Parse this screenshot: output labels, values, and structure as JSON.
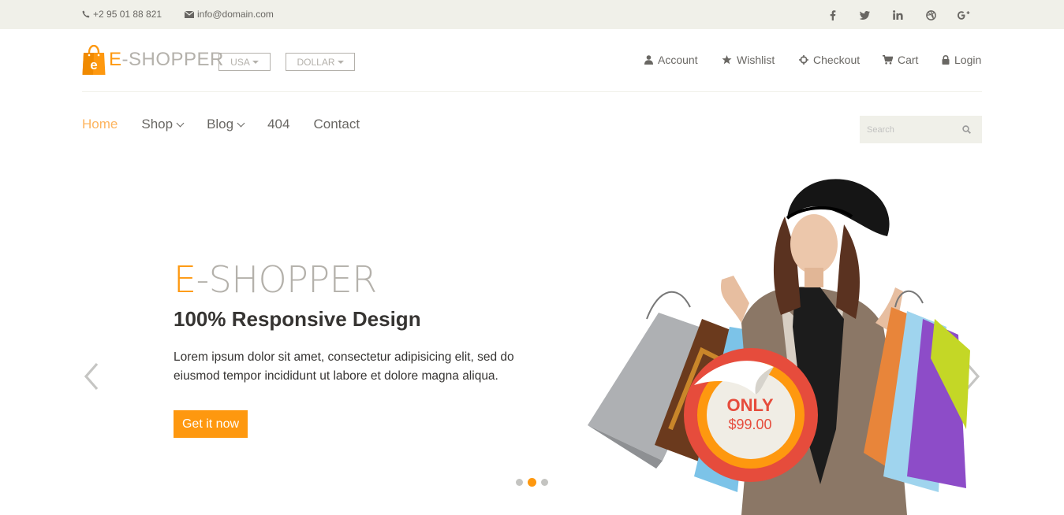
{
  "topbar": {
    "phone": "+2 95 01 88 821",
    "email": "info@domain.com",
    "social": [
      {
        "icon": "facebook-icon",
        "glyph": "f"
      },
      {
        "icon": "twitter-icon",
        "glyph": "t"
      },
      {
        "icon": "linkedin-icon",
        "glyph": "in"
      },
      {
        "icon": "dribbble-icon",
        "glyph": "d"
      },
      {
        "icon": "google-plus-icon",
        "glyph": "g+"
      }
    ]
  },
  "header": {
    "logo": {
      "first": "E",
      "rest": "-SHOPPER",
      "bag_letter": "e"
    },
    "country_select": "USA",
    "currency_select": "DOLLAR",
    "account_nav": [
      {
        "label": "Account",
        "icon": "user-icon"
      },
      {
        "label": "Wishlist",
        "icon": "star-icon"
      },
      {
        "label": "Checkout",
        "icon": "crosshairs-icon"
      },
      {
        "label": "Cart",
        "icon": "shopping-cart-icon"
      },
      {
        "label": "Login",
        "icon": "lock-icon"
      }
    ]
  },
  "nav": {
    "items": [
      {
        "label": "Home",
        "active": true
      },
      {
        "label": "Shop",
        "dropdown": true
      },
      {
        "label": "Blog",
        "dropdown": true
      },
      {
        "label": "404"
      },
      {
        "label": "Contact"
      }
    ],
    "search_placeholder": "Search"
  },
  "slider": {
    "title_first": "E",
    "title_rest": "-SHOPPER",
    "subtitle": "100% Responsive Design",
    "text": "Lorem ipsum dolor sit amet, consectetur adipisicing elit, sed do eiusmod tempor incididunt ut labore et dolore magna aliqua.",
    "button": "Get it now",
    "price_label": "ONLY",
    "price": "$99.00",
    "active_slide": 2,
    "slide_count": 3
  },
  "colors": {
    "accent": "#fe980f",
    "topbar_bg": "#f0f0e9",
    "text": "#696763",
    "dark_text": "#363432",
    "price_red": "#e64c3c"
  }
}
